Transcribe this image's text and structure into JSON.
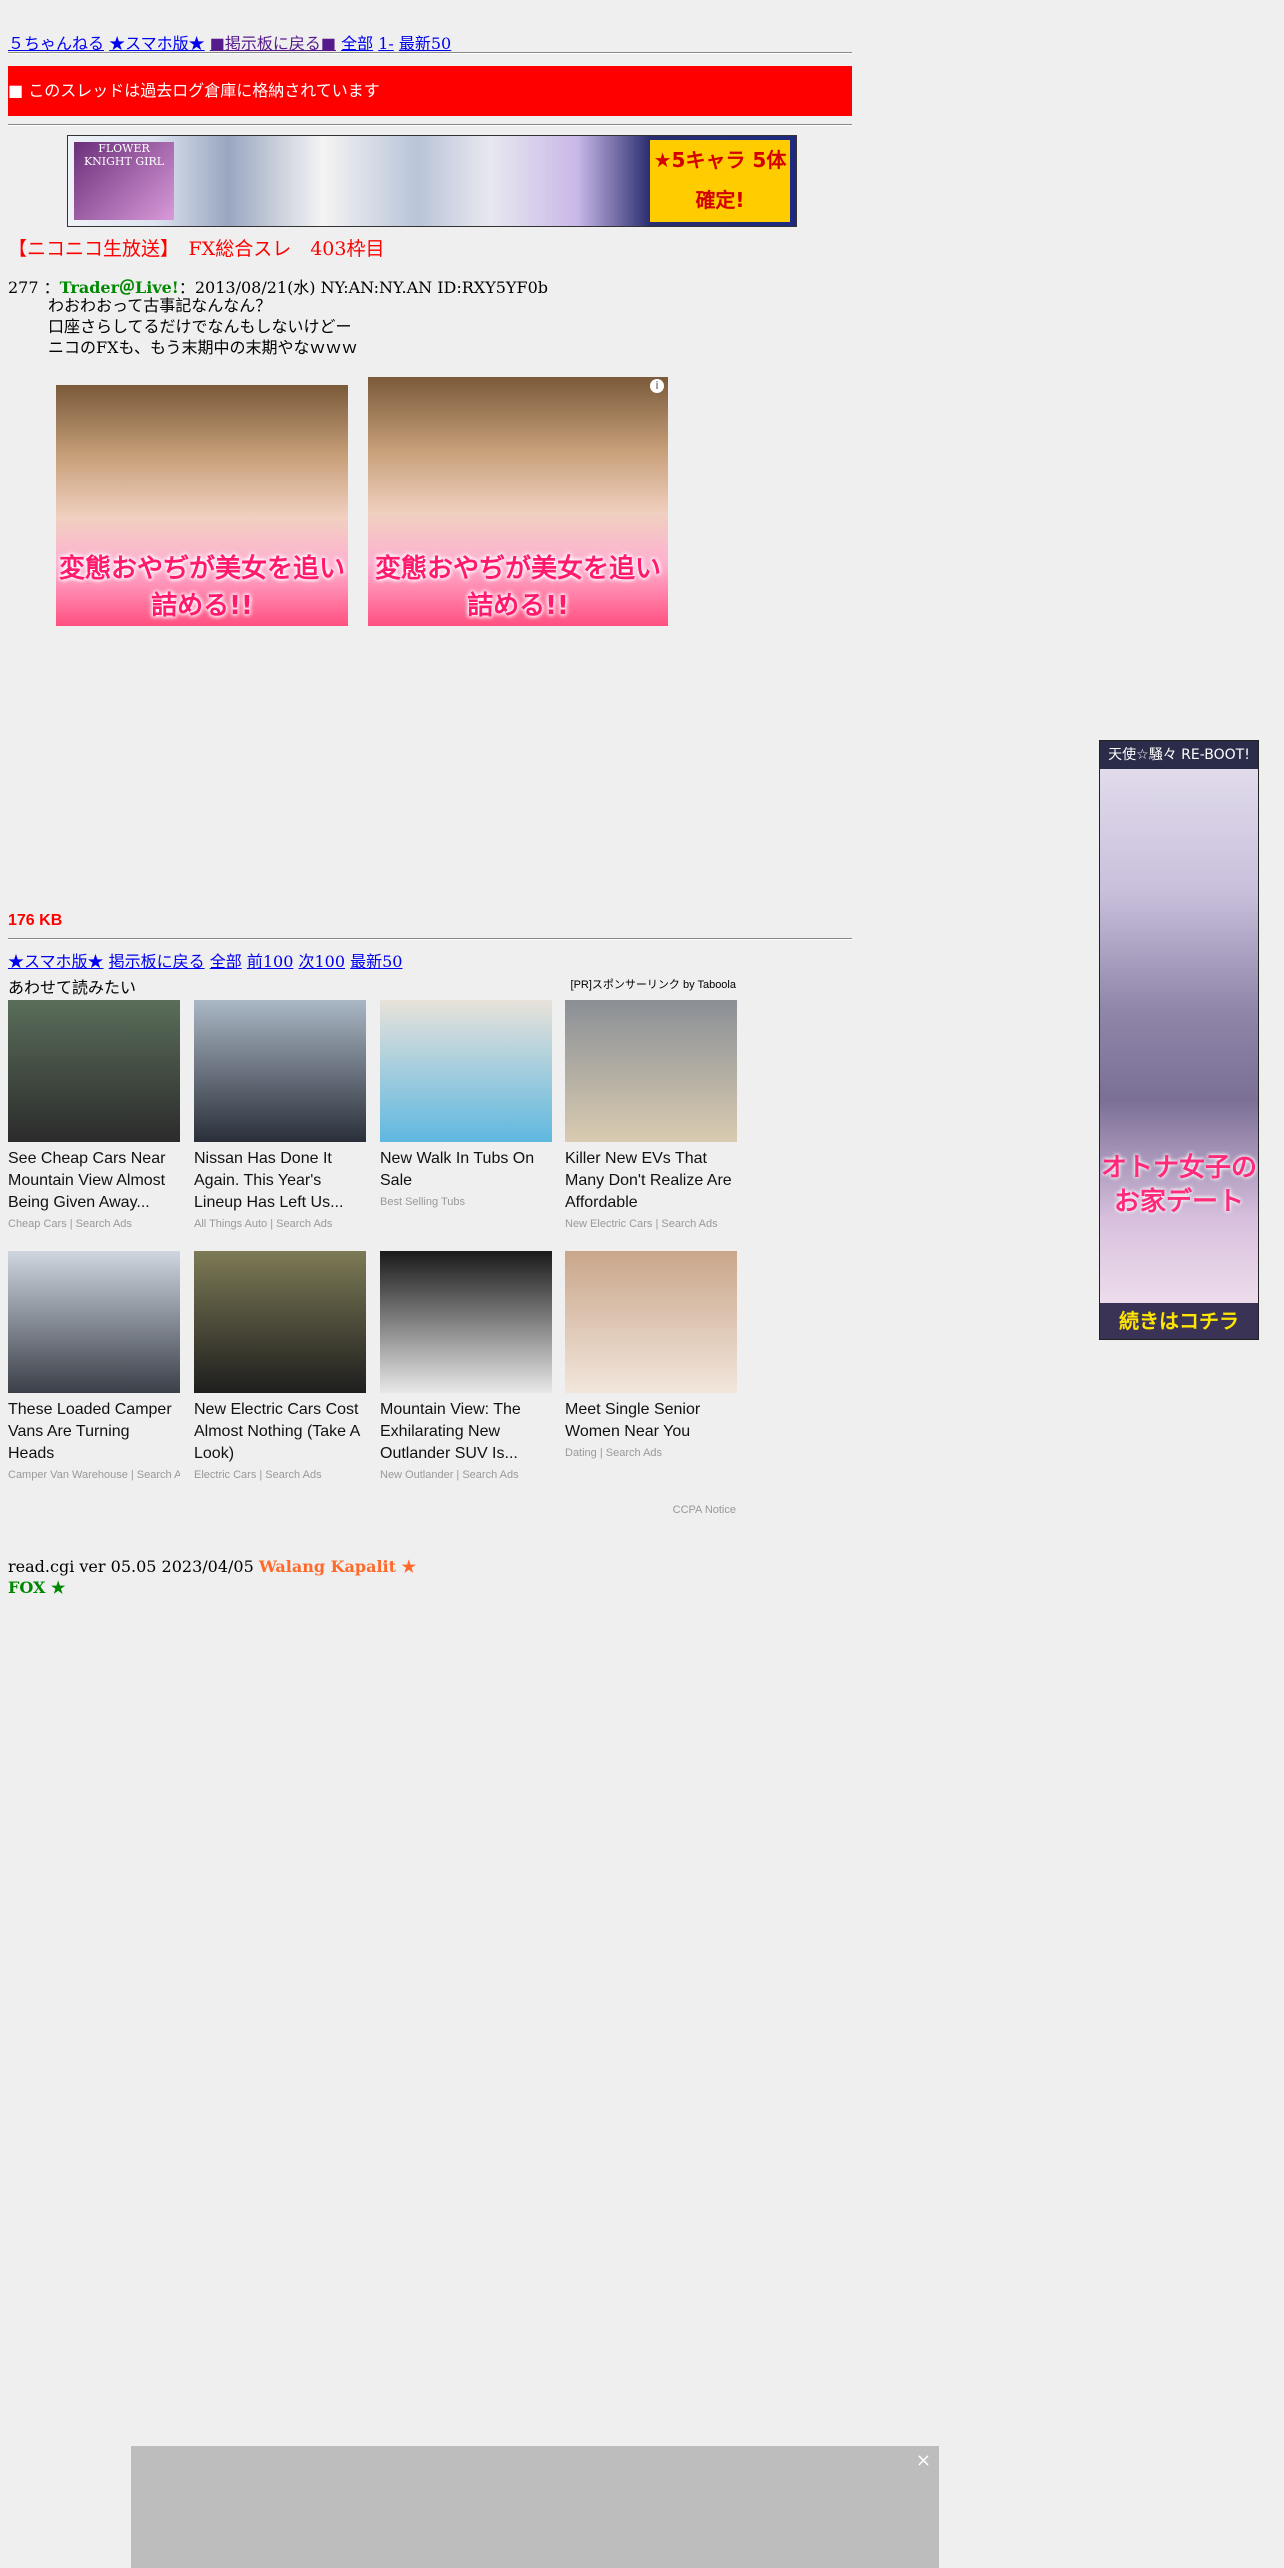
{
  "topnav": {
    "site": "５ちゃんねる",
    "smartphone": "★スマホ版★",
    "back_to_board": "■掲示板に戻る■",
    "all": "全部",
    "first": "1-",
    "latest50": "最新50"
  },
  "archive_notice": "■ このスレッドは過去ログ倉庫に格納されています",
  "top_ad": {
    "logo_text": "FLOWER KNIGHT GIRL",
    "sticker_text": "★5キャラ 5体確定!"
  },
  "thread_title": "【ニコニコ生放送】　FX総合スレ　403枠目",
  "post": {
    "number": "277",
    "separator1": "：",
    "name": "Trader＠Live!",
    "separator2": "：",
    "meta": "2013/08/21(水) NY:AN:NY.AN ID:RXY5YF0b",
    "lines": [
      "わおわおって古事記なんなん？",
      "口座さらしてるだけでなんもしないけどー",
      "ニコのFXも、もう末期中の末期やなｗｗｗ"
    ]
  },
  "post_ads": [
    {
      "caption": "変態おやぢが美女を追い詰める!!"
    },
    {
      "caption": "変態おやぢが美女を追い詰める!!",
      "info": "i"
    }
  ],
  "size_label": "176 KB",
  "bottomnav": {
    "smartphone": "★スマホ版★",
    "back_to_board": "掲示板に戻る",
    "all": "全部",
    "prev100": "前100",
    "next100": "次100",
    "latest50": "最新50"
  },
  "taboola": {
    "heading": "あわせて読みたい",
    "sponsor": "[PR]スポンサーリンク by Taboola",
    "cards": [
      {
        "title": "See Cheap Cars Near Mountain View Almost Being Given Away...",
        "source": "Cheap Cars | Search Ads",
        "color_top": "#5a6e5a",
        "color_bottom": "#2b2b2b"
      },
      {
        "title": "Nissan Has Done It Again. This Year's Lineup Has Left Us...",
        "source": "All Things Auto | Search Ads",
        "color_top": "#aab7c4",
        "color_bottom": "#2a2f3a"
      },
      {
        "title": "New Walk In Tubs On Sale",
        "source": "Best Selling Tubs",
        "color_top": "#e8e2da",
        "color_bottom": "#5fb8e0"
      },
      {
        "title": "Killer New EVs That Many Don't Realize Are Affordable",
        "source": "New Electric Cars | Search Ads",
        "color_top": "#8a8f96",
        "color_bottom": "#d9cbb0"
      },
      {
        "title": "These Loaded Camper Vans Are Turning Heads",
        "source": "Camper Van Warehouse | Search Ads",
        "color_top": "#cfd6df",
        "color_bottom": "#3a3f48"
      },
      {
        "title": "New Electric Cars Cost Almost Nothing (Take A Look)",
        "source": "Electric Cars | Search Ads",
        "color_top": "#7d7a55",
        "color_bottom": "#1e1e1e"
      },
      {
        "title": "Mountain View: The Exhilarating New Outlander SUV Is...",
        "source": "New Outlander | Search Ads",
        "color_top": "#1a1a1a",
        "color_bottom": "#e8e8e8"
      },
      {
        "title": "Meet Single Senior Women Near You",
        "source": "Dating | Search Ads",
        "color_top": "#c9a68a",
        "color_bottom": "#f2e6dc"
      }
    ],
    "ccpa": "CCPA Notice"
  },
  "footer": {
    "version": "read.cgi ver 05.05 2023/04/05",
    "walang": "Walang Kapalit ★",
    "fox": "FOX ★"
  },
  "side_ad": {
    "top_text": "天使☆騒々 RE-BOOT!",
    "mid_text": "オトナ女子のお家デート",
    "bottom_text": "続きはコチラ"
  },
  "overlay": {
    "close_glyph": "×"
  }
}
